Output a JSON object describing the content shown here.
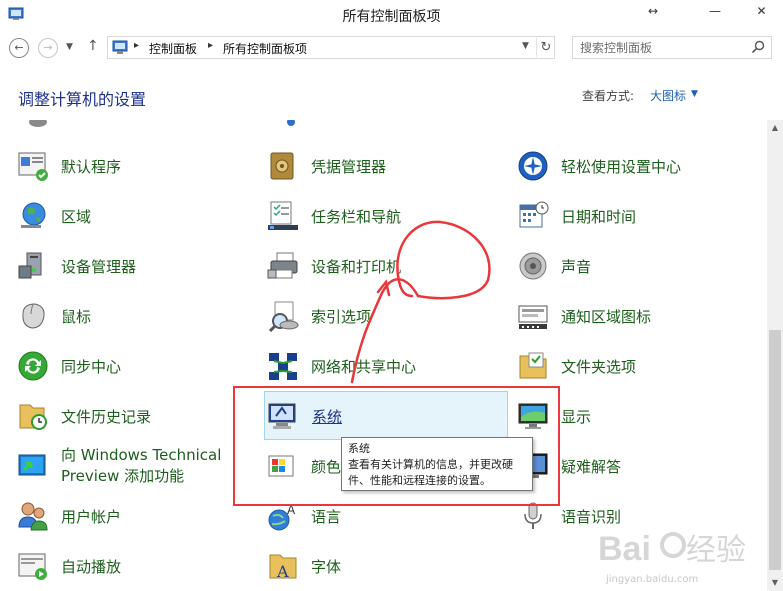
{
  "window": {
    "title": "所有控制面板项",
    "resize_glyph": "↔",
    "minimize_glyph": "—",
    "close_glyph": "✕"
  },
  "nav": {
    "back_glyph": "←",
    "forward_glyph": "→",
    "recent_glyph": "▼",
    "up_glyph": "↑"
  },
  "address": {
    "crumbs": [
      "控制面板",
      "所有控制面板项"
    ],
    "separator_glyph": "▸",
    "dropdown_glyph": "▼",
    "refresh_glyph": "↻"
  },
  "search": {
    "placeholder": "搜索控制面板",
    "icon": "search-icon"
  },
  "header": {
    "title": "调整计算机的设置",
    "view_by_label": "查看方式:",
    "view_by_value": "大图标",
    "view_by_arrow": "▼"
  },
  "items": [
    {
      "label": "默认程序",
      "icon": "default-programs-icon"
    },
    {
      "label": "凭据管理器",
      "icon": "credential-manager-icon"
    },
    {
      "label": "轻松使用设置中心",
      "icon": "ease-of-access-icon"
    },
    {
      "label": "区域",
      "icon": "region-globe-icon"
    },
    {
      "label": "任务栏和导航",
      "icon": "taskbar-icon"
    },
    {
      "label": "日期和时间",
      "icon": "calendar-clock-icon"
    },
    {
      "label": "设备管理器",
      "icon": "device-manager-icon"
    },
    {
      "label": "设备和打印机",
      "icon": "printer-icon"
    },
    {
      "label": "声音",
      "icon": "speaker-icon"
    },
    {
      "label": "鼠标",
      "icon": "mouse-icon"
    },
    {
      "label": "索引选项",
      "icon": "indexing-icon"
    },
    {
      "label": "通知区域图标",
      "icon": "notification-area-icon"
    },
    {
      "label": "同步中心",
      "icon": "sync-icon"
    },
    {
      "label": "网络和共享中心",
      "icon": "network-icon"
    },
    {
      "label": "文件夹选项",
      "icon": "folder-options-icon"
    },
    {
      "label": "文件历史记录",
      "icon": "file-history-icon"
    },
    {
      "label": "系统",
      "icon": "system-icon"
    },
    {
      "label": "显示",
      "icon": "display-icon"
    },
    {
      "label": "向 Windows Technical Preview 添加功能",
      "icon": "add-features-icon"
    },
    {
      "label": "颜色",
      "icon": "color-icon"
    },
    {
      "label": "疑难解答",
      "icon": "troubleshooting-icon"
    },
    {
      "label": "用户帐户",
      "icon": "user-accounts-icon"
    },
    {
      "label": "语言",
      "icon": "language-icon"
    },
    {
      "label": "语音识别",
      "icon": "microphone-icon"
    },
    {
      "label": "自动播放",
      "icon": "autoplay-icon"
    },
    {
      "label": "字体",
      "icon": "font-icon"
    }
  ],
  "tooltip": {
    "title": "系统",
    "description": "查看有关计算机的信息，并更改硬件、性能和远程连接的设置。"
  },
  "scrollbar": {
    "up_glyph": "▲",
    "down_glyph": "▼"
  },
  "watermark": {
    "url": "jingyan.baidu.com"
  },
  "colors": {
    "link_green": "#1d5e1d",
    "header_blue": "#1e3287",
    "highlight_bg": "#e5f3fb",
    "annotation_red": "#e8383b"
  }
}
